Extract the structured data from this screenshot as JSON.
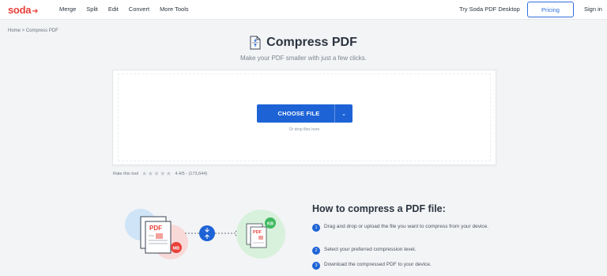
{
  "header": {
    "logo": "soda",
    "nav": [
      "Merge",
      "Split",
      "Edit",
      "Convert",
      "More Tools"
    ],
    "try_desktop": "Try Soda PDF Desktop",
    "pricing": "Pricing",
    "signin": "Sign in"
  },
  "breadcrumb": "Home > Compress PDF",
  "main": {
    "title": "Compress PDF",
    "subtitle": "Make your PDF smaller with just a few clicks."
  },
  "upload": {
    "button_label": "CHOOSE FILE",
    "drop_hint": "Or drop files here"
  },
  "rating": {
    "label": "Rate this tool",
    "score": "4.4/5 - (173,644)",
    "stars": 5
  },
  "illustration": {
    "file_label_left": "PDF",
    "badge_left": "MB",
    "file_label_right": "PDF",
    "badge_right": "KB"
  },
  "howto": {
    "title": "How to compress a PDF file:",
    "steps": [
      {
        "num": "1",
        "text": "Drag and drop or upload the file you want to compress from your device."
      },
      {
        "num": "2",
        "text": "Select your preferred compression level."
      },
      {
        "num": "3",
        "text": "Download the compressed PDF to your device."
      }
    ]
  },
  "colors": {
    "brand": "#e8413a",
    "accent": "#1d63d6",
    "background": "#f3f4f6"
  }
}
